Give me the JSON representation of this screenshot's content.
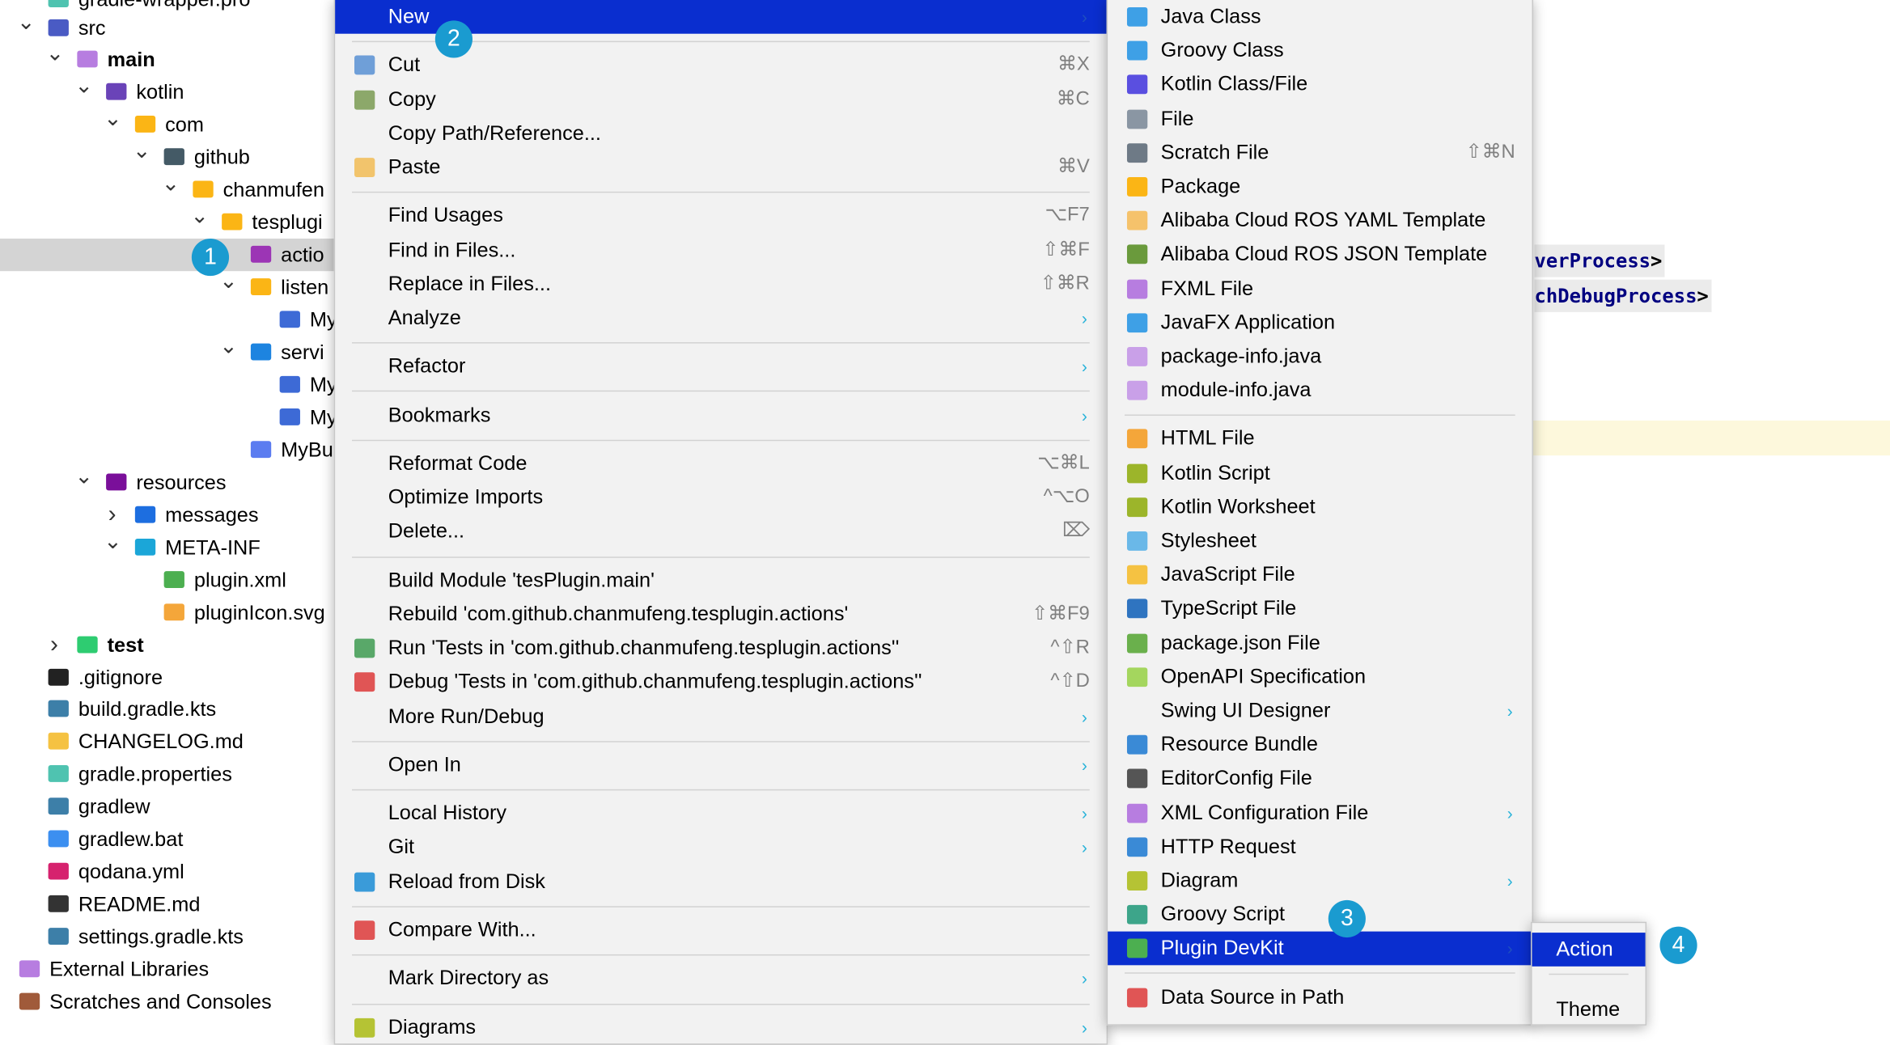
{
  "colors": {
    "accent": "#0a2ecf",
    "badge": "#1a9bd0",
    "selection": "#d4d4d4"
  },
  "tree": [
    {
      "label": "gradle-wrapper.pro",
      "level": 0,
      "chevron": "none",
      "icon": "properties-icon",
      "color": "#4fc3b0"
    },
    {
      "label": "src",
      "level": 0,
      "chevron": "down",
      "icon": "source-folder-icon",
      "color": "#4a5bc4"
    },
    {
      "label": "main",
      "level": 1,
      "chevron": "down",
      "icon": "module-folder-icon",
      "color": "#b77de0",
      "bold": true
    },
    {
      "label": "kotlin",
      "level": 2,
      "chevron": "down",
      "icon": "kotlin-folder-icon",
      "color": "#6a43b8"
    },
    {
      "label": "com",
      "level": 3,
      "chevron": "down",
      "icon": "package-icon",
      "color": "#fbb515"
    },
    {
      "label": "github",
      "level": 4,
      "chevron": "down",
      "icon": "github-folder-icon",
      "color": "#445a66"
    },
    {
      "label": "chanmufen",
      "level": 5,
      "chevron": "down",
      "icon": "package-icon",
      "color": "#fbb515"
    },
    {
      "label": "tesplugi",
      "level": 6,
      "chevron": "down",
      "icon": "package-icon",
      "color": "#fbb515"
    },
    {
      "label": "actio",
      "level": 7,
      "chevron": "none",
      "icon": "actions-folder-icon",
      "color": "#9c35b5",
      "selected": true
    },
    {
      "label": "listen",
      "level": 7,
      "chevron": "down",
      "icon": "package-icon",
      "color": "#fbb515"
    },
    {
      "label": "My",
      "level": 8,
      "chevron": "none",
      "icon": "class-icon",
      "color": "#3d6ad6"
    },
    {
      "label": "servi",
      "level": 7,
      "chevron": "down",
      "icon": "services-folder-icon",
      "color": "#1d84e0"
    },
    {
      "label": "My",
      "level": 8,
      "chevron": "none",
      "icon": "class-icon",
      "color": "#3d6ad6"
    },
    {
      "label": "My",
      "level": 8,
      "chevron": "none",
      "icon": "class-icon",
      "color": "#3d6ad6"
    },
    {
      "label": "MyBu",
      "level": 7,
      "chevron": "none",
      "icon": "translation-icon",
      "color": "#5b7cf0"
    },
    {
      "label": "resources",
      "level": 2,
      "chevron": "down",
      "icon": "resources-folder-icon",
      "color": "#7a0f9a"
    },
    {
      "label": "messages",
      "level": 3,
      "chevron": "right",
      "icon": "folder-icon",
      "color": "#1d6ee0"
    },
    {
      "label": "META-INF",
      "level": 3,
      "chevron": "down",
      "icon": "folder-icon",
      "color": "#1ba6d8"
    },
    {
      "label": "plugin.xml",
      "level": 4,
      "chevron": "none",
      "icon": "plugin-icon",
      "color": "#4caf50"
    },
    {
      "label": "pluginIcon.svg",
      "level": 4,
      "chevron": "none",
      "icon": "svg-icon",
      "color": "#f4a63a"
    },
    {
      "label": "test",
      "level": 1,
      "chevron": "right",
      "icon": "test-folder-icon",
      "color": "#2ecc71",
      "bold": true
    },
    {
      "label": ".gitignore",
      "level": 0,
      "chevron": "none",
      "icon": "git-icon",
      "color": "#222"
    },
    {
      "label": "build.gradle.kts",
      "level": 0,
      "chevron": "none",
      "icon": "gradle-icon",
      "color": "#3d7fa8"
    },
    {
      "label": "CHANGELOG.md",
      "level": 0,
      "chevron": "none",
      "icon": "changelog-icon",
      "color": "#f5c242"
    },
    {
      "label": "gradle.properties",
      "level": 0,
      "chevron": "none",
      "icon": "properties-icon",
      "color": "#4fc3b0"
    },
    {
      "label": "gradlew",
      "level": 0,
      "chevron": "none",
      "icon": "gradle-icon",
      "color": "#3d7fa8"
    },
    {
      "label": "gradlew.bat",
      "level": 0,
      "chevron": "none",
      "icon": "windows-icon",
      "color": "#3c8ff0"
    },
    {
      "label": "qodana.yml",
      "level": 0,
      "chevron": "none",
      "icon": "qodana-icon",
      "color": "#d6226e"
    },
    {
      "label": "README.md",
      "level": 0,
      "chevron": "none",
      "icon": "readme-icon",
      "color": "#333"
    },
    {
      "label": "settings.gradle.kts",
      "level": 0,
      "chevron": "none",
      "icon": "gradle-icon",
      "color": "#3d7fa8"
    },
    {
      "label": "External Libraries",
      "level": -1,
      "chevron": "right",
      "icon": "library-icon",
      "color": "#b77de0"
    },
    {
      "label": "Scratches and Consoles",
      "level": -1,
      "chevron": "right",
      "icon": "scratches-icon",
      "color": "#a05a3a"
    }
  ],
  "editor": {
    "lines": [
      "verProcess",
      ">",
      "chDebugProcess",
      ">"
    ]
  },
  "context_menu": [
    {
      "label": "New",
      "submenu": true,
      "highlighted": true
    },
    {
      "sep": true
    },
    {
      "label": "Cut",
      "shortcut": "⌘X",
      "icon": "scissors-icon",
      "color": "#6f9fd8"
    },
    {
      "label": "Copy",
      "shortcut": "⌘C",
      "icon": "copy-icon",
      "color": "#8ca86a"
    },
    {
      "label": "Copy Path/Reference..."
    },
    {
      "label": "Paste",
      "shortcut": "⌘V",
      "icon": "paste-icon",
      "color": "#f2c46c"
    },
    {
      "sep": true
    },
    {
      "label": "Find Usages",
      "shortcut": "⌥F7"
    },
    {
      "label": "Find in Files...",
      "shortcut": "⇧⌘F"
    },
    {
      "label": "Replace in Files...",
      "shortcut": "⇧⌘R"
    },
    {
      "label": "Analyze",
      "submenu": true
    },
    {
      "sep": true
    },
    {
      "label": "Refactor",
      "submenu": true
    },
    {
      "sep": true
    },
    {
      "label": "Bookmarks",
      "submenu": true
    },
    {
      "sep": true
    },
    {
      "label": "Reformat Code",
      "shortcut": "⌥⌘L"
    },
    {
      "label": "Optimize Imports",
      "shortcut": "^⌥O"
    },
    {
      "label": "Delete...",
      "shortcut": "⌦"
    },
    {
      "sep": true
    },
    {
      "label": "Build Module 'tesPlugin.main'"
    },
    {
      "label": "Rebuild 'com.github.chanmufeng.tesplugin.actions'",
      "shortcut": "⇧⌘F9"
    },
    {
      "label": "Run 'Tests in 'com.github.chanmufeng.tesplugin.actions''",
      "shortcut": "^⇧R",
      "icon": "run-icon",
      "color": "#59a869"
    },
    {
      "label": "Debug 'Tests in 'com.github.chanmufeng.tesplugin.actions''",
      "shortcut": "^⇧D",
      "icon": "debug-icon",
      "color": "#e05555"
    },
    {
      "label": "More Run/Debug",
      "submenu": true
    },
    {
      "sep": true
    },
    {
      "label": "Open In",
      "submenu": true
    },
    {
      "sep": true
    },
    {
      "label": "Local History",
      "submenu": true
    },
    {
      "label": "Git",
      "submenu": true
    },
    {
      "label": "Reload from Disk",
      "icon": "reload-icon",
      "color": "#3a9bd9"
    },
    {
      "sep": true
    },
    {
      "label": "Compare With...",
      "icon": "compare-icon",
      "color": "#e05555"
    },
    {
      "sep": true
    },
    {
      "label": "Mark Directory as",
      "submenu": true
    },
    {
      "sep": true
    },
    {
      "label": "Diagrams",
      "submenu": true,
      "icon": "diagram-icon",
      "color": "#b5c334"
    }
  ],
  "new_submenu": [
    {
      "label": "Java Class",
      "icon": "java-class-icon",
      "color": "#3ea0e6"
    },
    {
      "label": "Groovy Class",
      "icon": "groovy-class-icon",
      "color": "#3ea0e6"
    },
    {
      "label": "Kotlin Class/File",
      "icon": "kotlin-icon",
      "color": "#5a4fe0"
    },
    {
      "label": "File",
      "icon": "file-icon",
      "color": "#8a96a3"
    },
    {
      "label": "Scratch File",
      "shortcut": "⇧⌘N",
      "icon": "scratch-file-icon",
      "color": "#6e7a86"
    },
    {
      "label": "Package",
      "icon": "package-icon",
      "color": "#fbb515"
    },
    {
      "label": "Alibaba Cloud ROS YAML Template",
      "icon": "yaml-icon",
      "color": "#f5c26b"
    },
    {
      "label": "Alibaba Cloud ROS JSON Template",
      "icon": "json-icon",
      "color": "#6a9a3c"
    },
    {
      "label": "FXML File",
      "icon": "fxml-icon",
      "color": "#b77de0"
    },
    {
      "label": "JavaFX Application",
      "icon": "javafx-icon",
      "color": "#3ea0e6"
    },
    {
      "label": "package-info.java",
      "icon": "java-icon",
      "color": "#c9a0e8"
    },
    {
      "label": "module-info.java",
      "icon": "java-icon",
      "color": "#c9a0e8"
    },
    {
      "sep": true
    },
    {
      "label": "HTML File",
      "icon": "html-icon",
      "color": "#f4a63a"
    },
    {
      "label": "Kotlin Script",
      "icon": "kotlin-script-icon",
      "color": "#9cb52a"
    },
    {
      "label": "Kotlin Worksheet",
      "icon": "kotlin-worksheet-icon",
      "color": "#9cb52a"
    },
    {
      "label": "Stylesheet",
      "icon": "css-icon",
      "color": "#6ab8e8"
    },
    {
      "label": "JavaScript File",
      "icon": "javascript-icon",
      "color": "#f5c242"
    },
    {
      "label": "TypeScript File",
      "icon": "typescript-icon",
      "color": "#2f74c0"
    },
    {
      "label": "package.json File",
      "icon": "nodejs-icon",
      "color": "#6ab04c"
    },
    {
      "label": "OpenAPI Specification",
      "icon": "openapi-icon",
      "color": "#a4d65e"
    },
    {
      "label": "Swing UI Designer",
      "submenu": true
    },
    {
      "label": "Resource Bundle",
      "icon": "resource-bundle-icon",
      "color": "#3a8ad6"
    },
    {
      "label": "EditorConfig File",
      "icon": "editorconfig-icon",
      "color": "#555"
    },
    {
      "label": "XML Configuration File",
      "submenu": true,
      "icon": "xml-icon",
      "color": "#b77de0"
    },
    {
      "label": "HTTP Request",
      "icon": "http-icon",
      "color": "#3a8ad6"
    },
    {
      "label": "Diagram",
      "submenu": true,
      "icon": "diagram-icon",
      "color": "#b5c334"
    },
    {
      "label": "Groovy Script",
      "icon": "groovy-script-icon",
      "color": "#3da58a"
    },
    {
      "label": "Plugin DevKit",
      "submenu": true,
      "highlighted": true,
      "icon": "plugin-icon",
      "color": "#4caf50"
    },
    {
      "sep": true
    },
    {
      "label": "Data Source in Path",
      "icon": "database-icon",
      "color": "#e05555"
    }
  ],
  "devkit_submenu": [
    {
      "label": "Action",
      "highlighted": true
    },
    {
      "sep": true
    },
    {
      "label": "Theme"
    }
  ],
  "badges": [
    "1",
    "2",
    "3",
    "4"
  ]
}
